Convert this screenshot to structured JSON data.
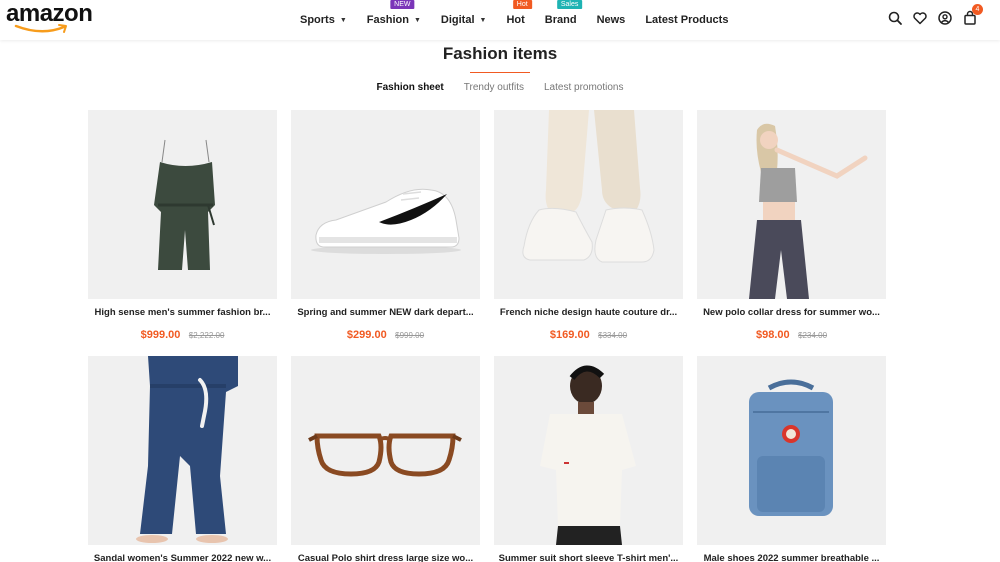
{
  "header": {
    "logo": "amazon",
    "nav": [
      {
        "label": "Sports",
        "dropdown": true,
        "badge": ""
      },
      {
        "label": "Fashion",
        "dropdown": true,
        "badge": "NEW"
      },
      {
        "label": "Digital",
        "dropdown": true,
        "badge": ""
      },
      {
        "label": "Hot",
        "dropdown": false,
        "badge": "Hot"
      },
      {
        "label": "Brand",
        "dropdown": false,
        "badge": "Sales"
      },
      {
        "label": "News",
        "dropdown": false,
        "badge": ""
      },
      {
        "label": "Latest Products",
        "dropdown": false,
        "badge": ""
      }
    ],
    "icons": [
      "search-icon",
      "heart-icon",
      "user-icon",
      "bag-icon"
    ],
    "cart_count": "4"
  },
  "section": {
    "title": "Fashion items",
    "tabs": [
      "Fashion sheet",
      "Trendy outfits",
      "Latest promotions"
    ],
    "active_tab": "Fashion sheet"
  },
  "products": [
    {
      "name": "High sense men's summer fashion br...",
      "price": "$999.00",
      "old_price": "$2,222.00",
      "image": "green-romper"
    },
    {
      "name": "Spring and summer NEW dark depart...",
      "price": "$299.00",
      "old_price": "$999.00",
      "image": "white-sneaker"
    },
    {
      "name": "French niche design haute couture dr...",
      "price": "$169.00",
      "old_price": "$334.00",
      "image": "beige-joggers-sneakers"
    },
    {
      "name": "New polo collar dress for summer wo...",
      "price": "$98.00",
      "old_price": "$234.00",
      "image": "woman-crop-top"
    },
    {
      "name": "Sandal women's Summer 2022 new w...",
      "price": "",
      "old_price": "",
      "image": "navy-pajama-pants"
    },
    {
      "name": "Casual Polo shirt dress large size wo...",
      "price": "",
      "old_price": "",
      "image": "tortoise-glasses"
    },
    {
      "name": "Summer suit short sleeve T-shirt men'...",
      "price": "",
      "old_price": "",
      "image": "man-white-tshirt"
    },
    {
      "name": "Male shoes 2022 summer breathable ...",
      "price": "",
      "old_price": "",
      "image": "blue-backpack"
    }
  ],
  "colors": {
    "accent": "#f15a22",
    "new_badge": "#7b35b8",
    "sales_badge": "#1eb3b3",
    "thumb_bg": "#f0f0f0"
  }
}
